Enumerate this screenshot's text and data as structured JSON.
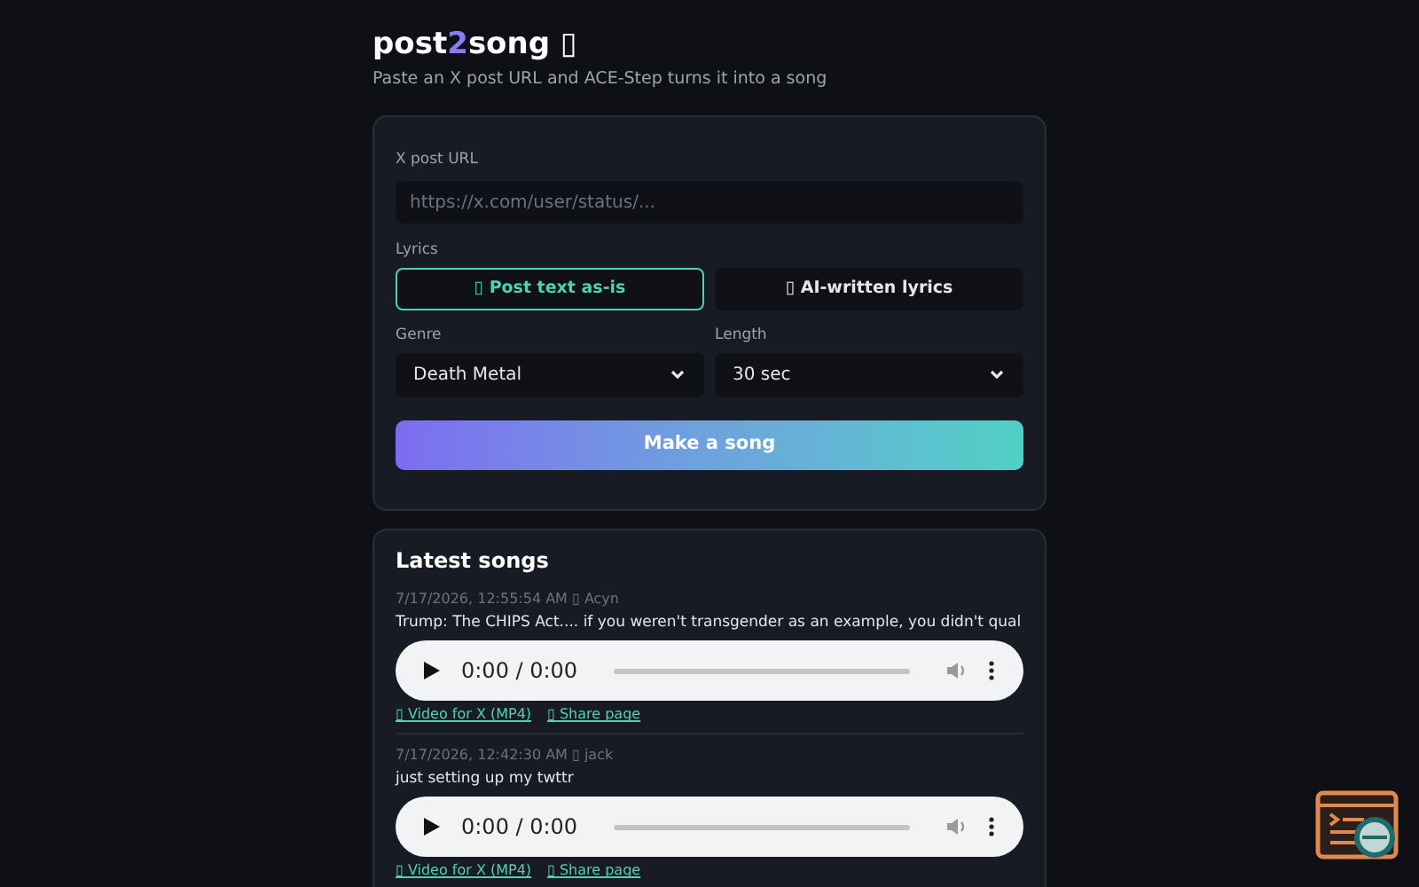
{
  "header": {
    "title_parts": [
      {
        "text": "post",
        "accent": false
      },
      {
        "text": "2",
        "accent": true
      },
      {
        "text": "song",
        "accent": false
      },
      {
        "text": " ▯",
        "accent": false
      }
    ],
    "subtitle": "Paste an X post URL and ACE-Step turns it into a song"
  },
  "form": {
    "url_label": "X post URL",
    "url_placeholder": "https://x.com/user/status/...",
    "lyrics_label": "Lyrics",
    "lyrics_options": [
      {
        "label": "▯ Post text as-is",
        "selected": true
      },
      {
        "label": "▯ AI-written lyrics",
        "selected": false
      }
    ],
    "genre_label": "Genre",
    "genre": "Death Metal",
    "length_label": "Length",
    "length": "30 sec",
    "submit": "Make a song"
  },
  "latest": {
    "title": "Latest songs",
    "songs": [
      {
        "meta": "7/17/2026, 12:55:54 AM ▯ Acyn",
        "text": "Trump: The CHIPS Act.... if you weren't transgender as an example, you didn't qual",
        "time": "0:00 / 0:00",
        "links": [
          "▯ Video for X (MP4)",
          "▯ Share page"
        ]
      },
      {
        "meta": "7/17/2026, 12:42:30 AM ▯ jack",
        "text": "just setting up my twttr",
        "time": "0:00 / 0:00",
        "links": [
          "▯ Video for X (MP4)",
          "▯ Share page"
        ]
      }
    ]
  }
}
